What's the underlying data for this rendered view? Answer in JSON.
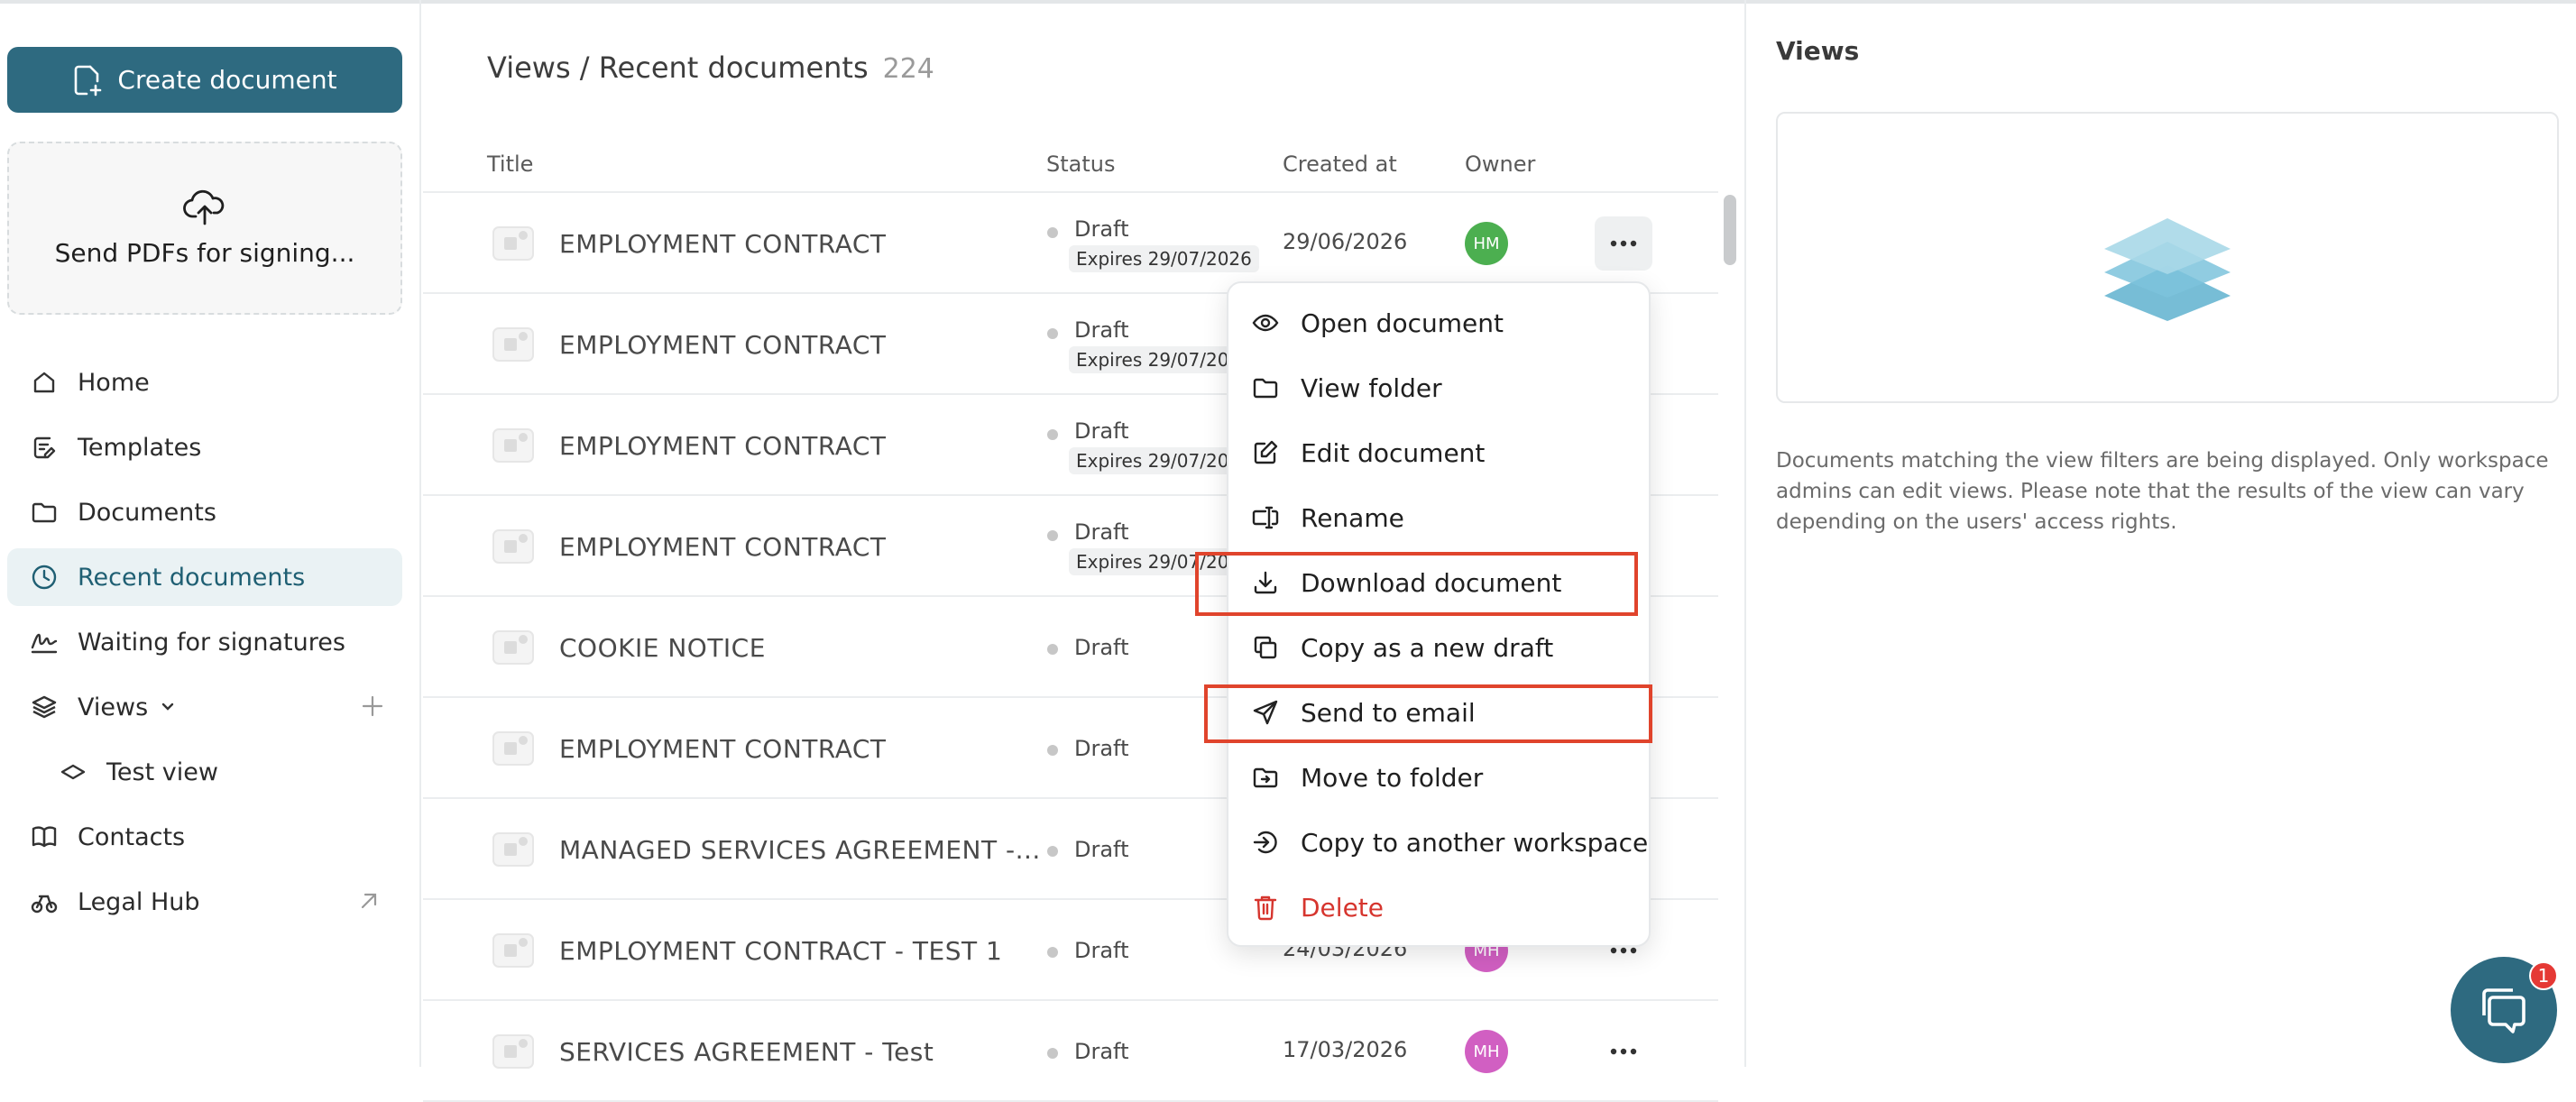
{
  "sidebar": {
    "create_label": "Create document",
    "upload_label": "Send PDFs for signing...",
    "items": [
      {
        "label": "Home",
        "icon": "home-icon"
      },
      {
        "label": "Templates",
        "icon": "templates-icon"
      },
      {
        "label": "Documents",
        "icon": "folder-icon"
      },
      {
        "label": "Recent documents",
        "icon": "clock-icon",
        "active": true
      },
      {
        "label": "Waiting for signatures",
        "icon": "signature-icon"
      },
      {
        "label": "Views",
        "icon": "layers-icon"
      },
      {
        "label": "Test view",
        "icon": "view-icon"
      },
      {
        "label": "Contacts",
        "icon": "book-icon"
      },
      {
        "label": "Legal Hub",
        "icon": "scale-icon"
      }
    ]
  },
  "main": {
    "breadcrumb": "Views / Recent documents",
    "count": "224",
    "columns": {
      "title": "Title",
      "status": "Status",
      "created": "Created at",
      "owner": "Owner"
    },
    "rows": [
      {
        "title": "EMPLOYMENT CONTRACT",
        "status": "Draft",
        "expires": "Expires 29/07/2026",
        "date": "29/06/2026",
        "owner": "HM",
        "owner_color": "#4caf50"
      },
      {
        "title": "EMPLOYMENT CONTRACT",
        "status": "Draft",
        "expires": "Expires 29/07/2026",
        "date": "",
        "owner": "",
        "owner_color": ""
      },
      {
        "title": "EMPLOYMENT CONTRACT",
        "status": "Draft",
        "expires": "Expires 29/07/2026",
        "date": "",
        "owner": "",
        "owner_color": ""
      },
      {
        "title": "EMPLOYMENT CONTRACT",
        "status": "Draft",
        "expires": "Expires 29/07/2026",
        "date": "",
        "owner": "",
        "owner_color": ""
      },
      {
        "title": "COOKIE NOTICE",
        "status": "Draft",
        "expires": "",
        "date": "",
        "owner": "",
        "owner_color": ""
      },
      {
        "title": "EMPLOYMENT CONTRACT",
        "status": "Draft",
        "expires": "",
        "date": "",
        "owner": "",
        "owner_color": ""
      },
      {
        "title": "MANAGED SERVICES AGREEMENT -...",
        "status": "Draft",
        "expires": "",
        "date": "",
        "owner": "",
        "owner_color": ""
      },
      {
        "title": "EMPLOYMENT CONTRACT - TEST 1",
        "status": "Draft",
        "expires": "",
        "date": "24/03/2026",
        "owner": "MH",
        "owner_color": "#d15fc2"
      },
      {
        "title": "SERVICES AGREEMENT - Test",
        "status": "Draft",
        "expires": "",
        "date": "17/03/2026",
        "owner": "MH",
        "owner_color": "#d15fc2"
      }
    ]
  },
  "menu": {
    "items": [
      {
        "label": "Open document",
        "icon": "eye-icon"
      },
      {
        "label": "View folder",
        "icon": "folder-icon"
      },
      {
        "label": "Edit document",
        "icon": "edit-icon"
      },
      {
        "label": "Rename",
        "icon": "rename-icon"
      },
      {
        "label": "Download document",
        "icon": "download-icon",
        "highlighted": true
      },
      {
        "label": "Copy as a new draft",
        "icon": "copy-icon"
      },
      {
        "label": "Send to email",
        "icon": "send-icon",
        "highlighted": true
      },
      {
        "label": "Move to folder",
        "icon": "move-folder-icon"
      },
      {
        "label": "Copy to another workspace",
        "icon": "workspace-icon"
      },
      {
        "label": "Delete",
        "icon": "trash-icon",
        "danger": true
      }
    ],
    "highlight_color": "#e0442c"
  },
  "right_panel": {
    "title": "Views",
    "description": "Documents matching the view filters are being displayed. Only workspace admins can edit views. Please note that the results of the view can vary depending on the users' access rights."
  },
  "chat": {
    "badge": "1",
    "icon": "chat-icon"
  },
  "colors": {
    "brand": "#2e6a80",
    "active_bg": "#eaf2f4",
    "danger": "#d6352e"
  }
}
